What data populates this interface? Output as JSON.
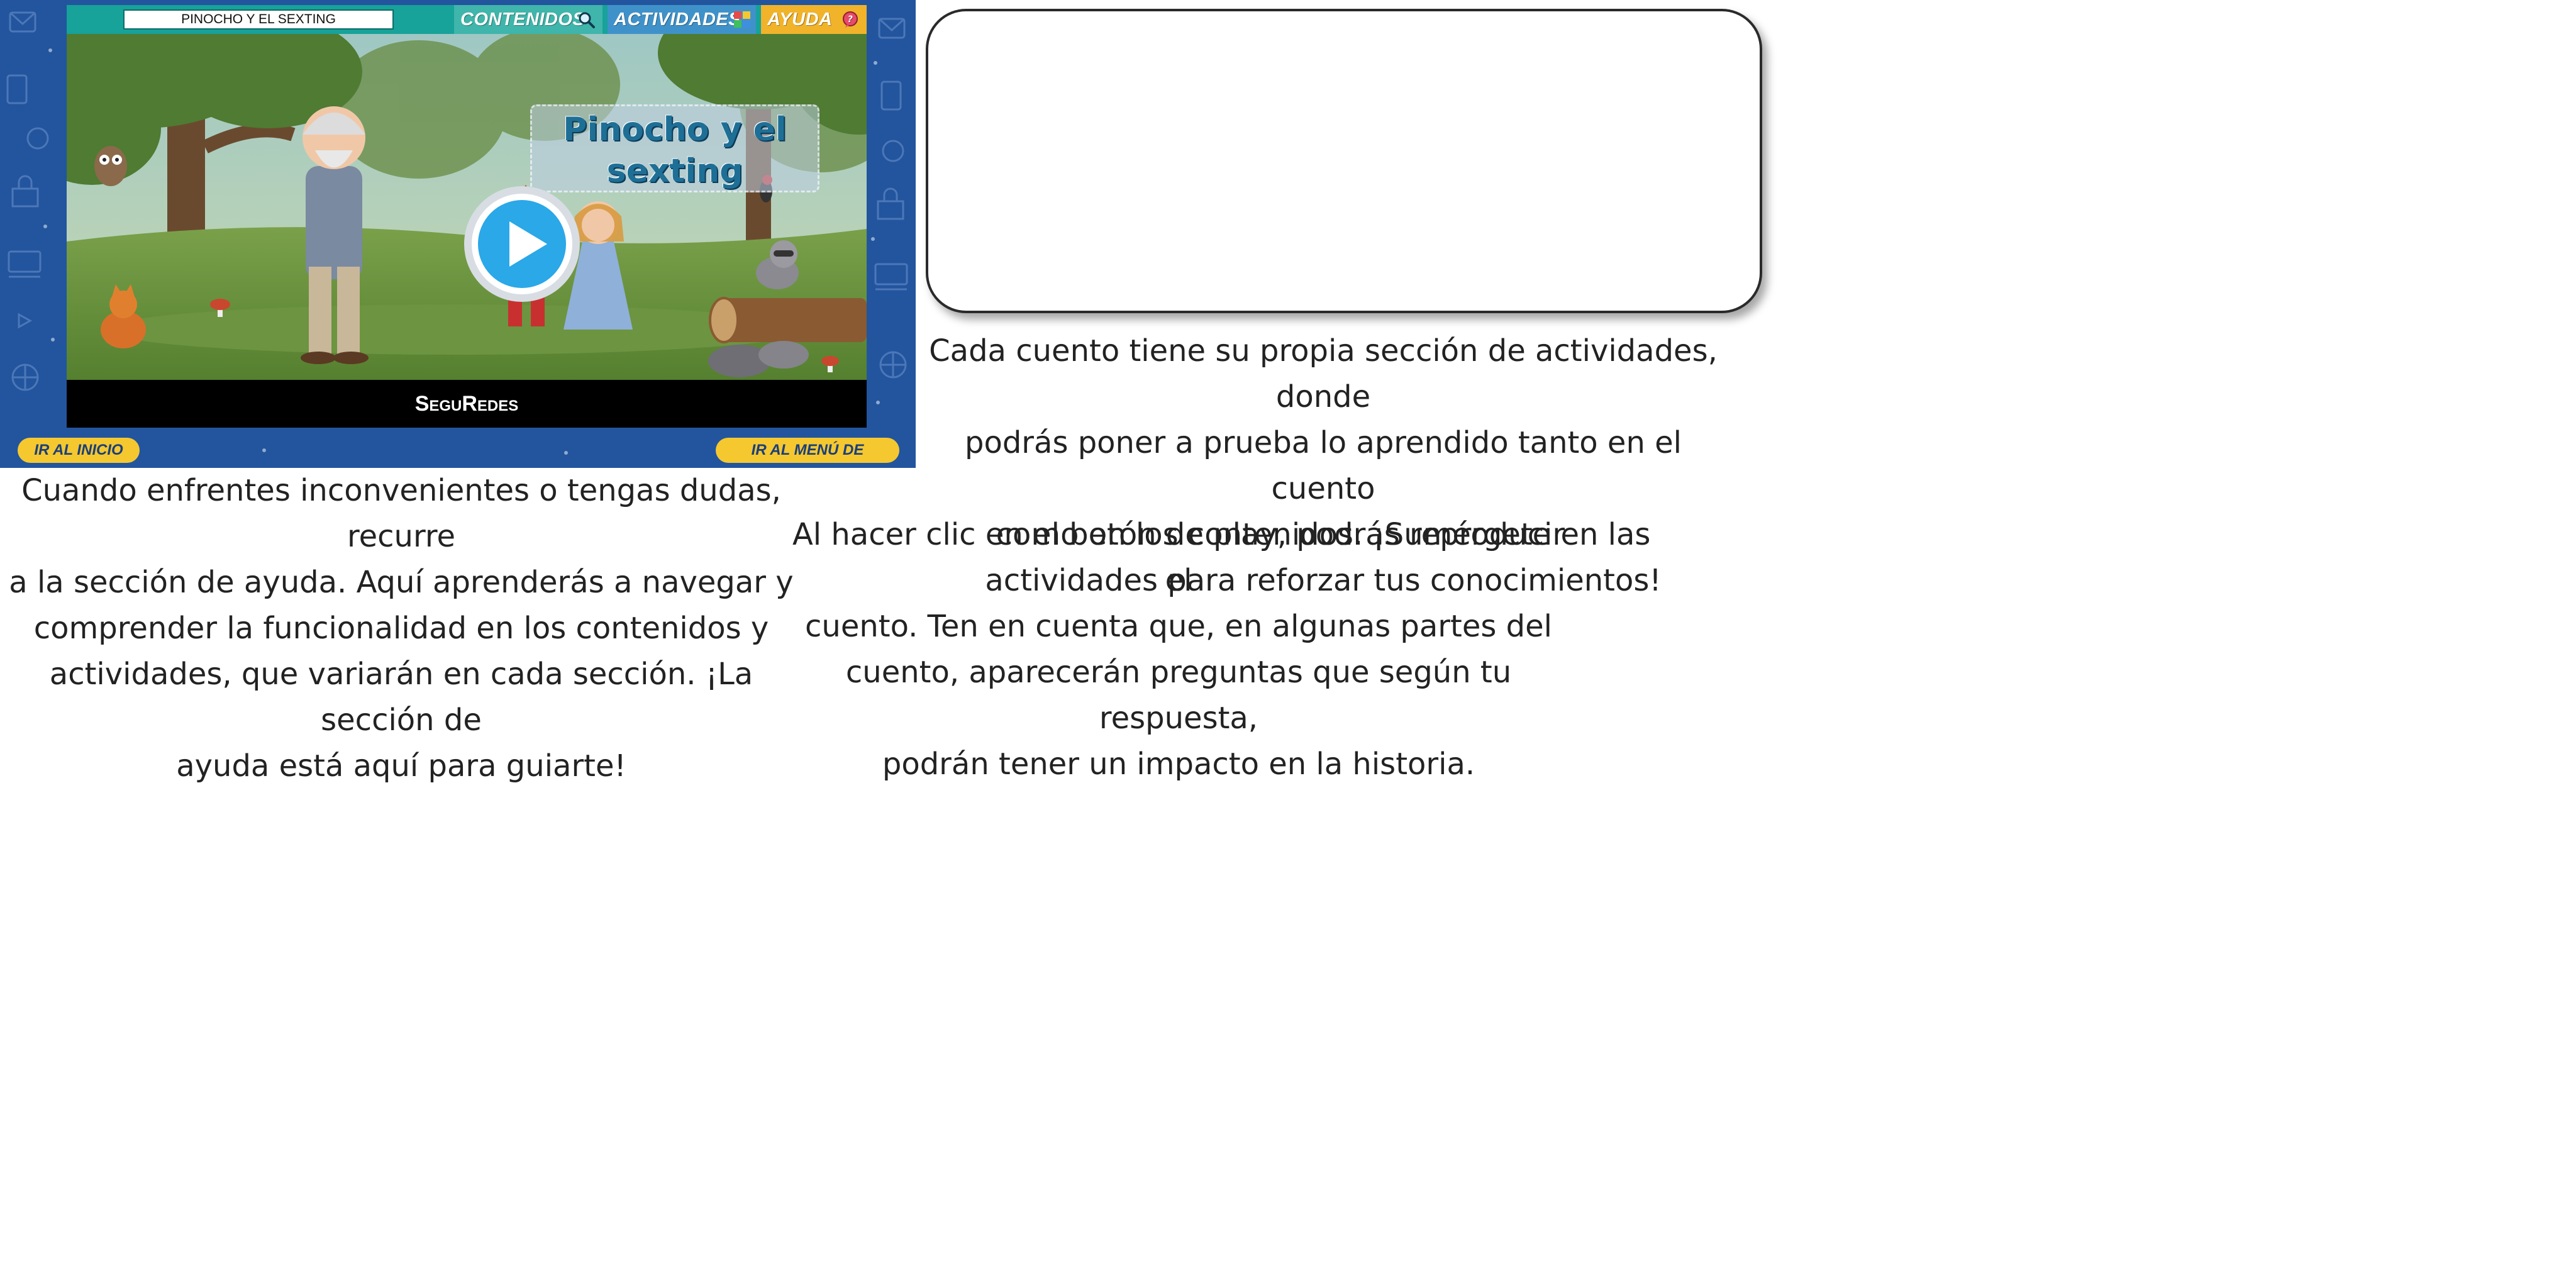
{
  "player": {
    "title_bar": "PINOCHO Y EL SEXTING",
    "menu": {
      "contenidos": "CONTENIDOS",
      "actividades": "ACTIVIDADES",
      "ayuda": "AYUDA"
    },
    "story_title_line1": "Pinocho y el",
    "story_title_line2": "sexting",
    "credits": "SeguRedes",
    "nav_home": "IR AL INICIO",
    "nav_stories": "IR AL MENÚ DE CUENTOS"
  },
  "info": {
    "activities": [
      "Cada cuento tiene su propia sección de actividades, donde",
      "podrás poner a prueba lo aprendido tanto en el cuento",
      "como en los contenidos. ¡Sumérgete en las",
      "actividades para reforzar tus conocimientos!"
    ],
    "help": [
      "Cuando enfrentes inconvenientes o tengas dudas, recurre",
      "a la sección de ayuda. Aquí aprenderás a navegar y",
      "comprender la funcionalidad en los contenidos y",
      "actividades, que variarán en cada sección. ¡La sección de",
      "ayuda está aquí para guiarte!"
    ],
    "play": [
      "Al hacer clic en el botón de play, podrás reproducir el",
      "cuento. Ten en cuenta que, en algunas partes del",
      "cuento, aparecerán preguntas que según tu respuesta,",
      "podrán tener un impacto en la historia."
    ]
  },
  "colors": {
    "frame_blue": "#22559e",
    "topbar_teal": "#17a29a",
    "contenidos": "#3fb5ab",
    "actividades": "#3f92c9",
    "ayuda": "#f1b32a",
    "nav_yellow": "#f5c830",
    "play_blue": "#2aa8e8"
  },
  "icons": {
    "contenidos": "magnifier-icon",
    "actividades": "puzzle-icon",
    "ayuda": "help-bubble-icon",
    "play": "play-icon"
  }
}
